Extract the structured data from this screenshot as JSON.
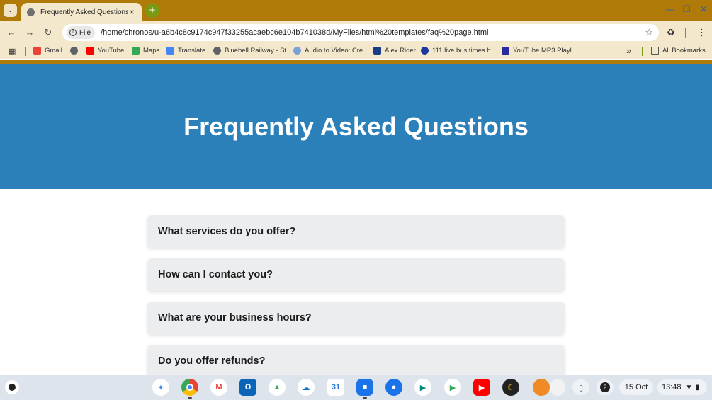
{
  "browser": {
    "tab_title": "Frequently Asked Questions",
    "tab_close": "×",
    "new_tab": "+",
    "file_chip": "File",
    "url": "/home/chronos/u-a6b4c8c9174c947f33255acaebc6e104b741038d/MyFiles/html%20templates/faq%20page.html",
    "bookmarks": [
      {
        "label": "Gmail",
        "icon": "gmail-icon",
        "color": "#ea4335"
      },
      {
        "label": "",
        "icon": "globe-icon",
        "color": "#5f6368"
      },
      {
        "label": "YouTube",
        "icon": "youtube-icon",
        "color": "#ff0000"
      },
      {
        "label": "Maps",
        "icon": "maps-icon",
        "color": "#34a853"
      },
      {
        "label": "Translate",
        "icon": "translate-icon",
        "color": "#4285f4"
      },
      {
        "label": "Bluebell Railway - St...",
        "icon": "globe-icon",
        "color": "#5f6368"
      },
      {
        "label": "Audio to Video: Cre...",
        "icon": "audio-icon",
        "color": "#7aa0d8"
      },
      {
        "label": "Alex Rider",
        "icon": "alex-rider-icon",
        "color": "#1a3a8a"
      },
      {
        "label": "111 live bus times h...",
        "icon": "tfl-icon",
        "color": "#1a3aa0"
      },
      {
        "label": "YouTube MP3 Playl...",
        "icon": "mp3-icon",
        "color": "#2a2aa0"
      }
    ],
    "bookmarks_overflow": "»",
    "all_bookmarks": "All Bookmarks"
  },
  "page": {
    "title": "Frequently Asked Questions",
    "faqs": [
      {
        "question": "What services do you offer?"
      },
      {
        "question": "How can I contact you?"
      },
      {
        "question": "What are your business hours?"
      },
      {
        "question": "Do you offer refunds?"
      }
    ]
  },
  "shelf": {
    "notification_count": "2",
    "date": "15 Oct",
    "time": "13:48"
  },
  "colors": {
    "frame": "#b07a08",
    "hero": "#2b80ba",
    "faq_bg": "#ecedef"
  }
}
